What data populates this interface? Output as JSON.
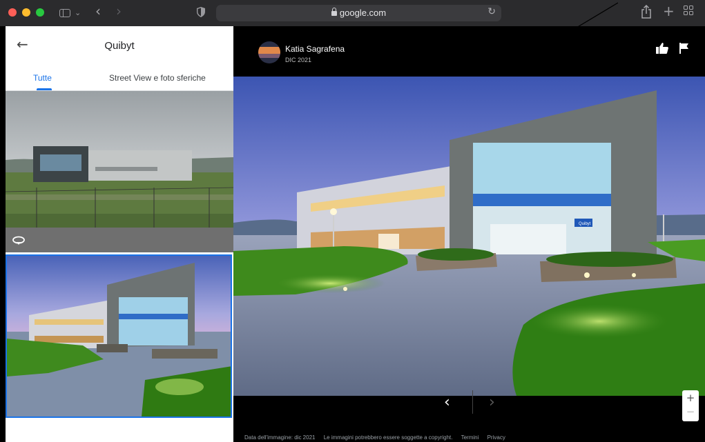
{
  "browser": {
    "url": "google.com",
    "icons": [
      "sidebar-icon",
      "back-icon",
      "forward-icon",
      "shield-icon",
      "lock-icon",
      "reload-icon",
      "share-icon",
      "plus-icon",
      "tabs-grid-icon"
    ]
  },
  "left_panel": {
    "title": "Quibyt",
    "tabs": [
      {
        "label": "Tutte",
        "active": true
      },
      {
        "label": "Street View e foto sferiche",
        "active": false
      }
    ],
    "accent_color": "#1a73e8"
  },
  "viewer": {
    "author": "Katia Sagrafena",
    "date": "DIC 2021",
    "photo_sign": "Quibyt",
    "footer": {
      "image_date": "Data dell'immagine: dic 2021",
      "copyright": "Le immagini potrebbero essere soggette a copyright.",
      "terms": "Termini",
      "privacy": "Privacy"
    },
    "zoom_in": "+",
    "zoom_out": "−"
  }
}
